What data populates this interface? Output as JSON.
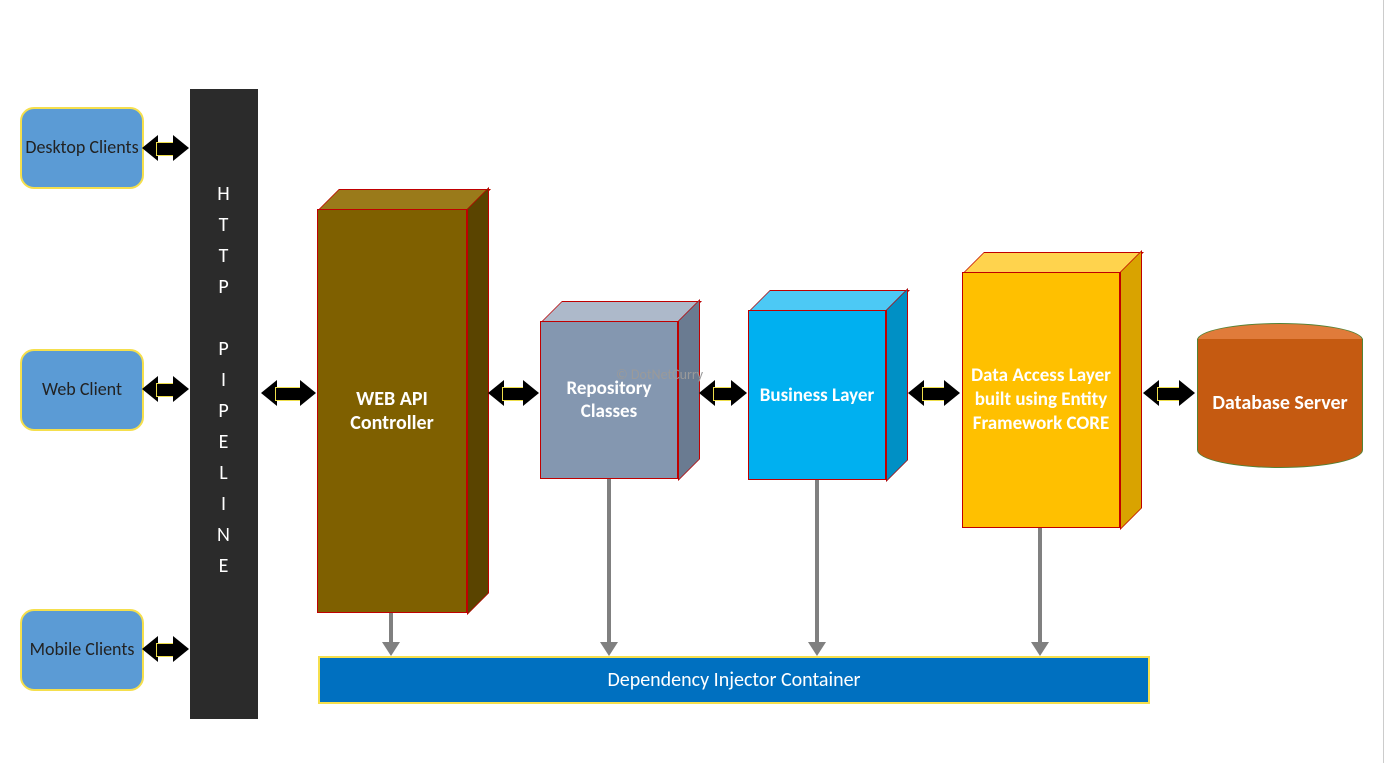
{
  "clients": {
    "desktop": "Desktop Clients",
    "web": "Web Client",
    "mobile": "Mobile Clients"
  },
  "pipeline": {
    "label_chars": "H\nT\nT\nP\n\nP\nI\nP\nE\nL\nI\nN\nE"
  },
  "cubes": {
    "webapi": "WEB API Controller",
    "repo": "Repository Classes",
    "biz": "Business Layer",
    "dal": "Data Access Layer built using Entity Framework CORE"
  },
  "database": "Database Server",
  "di_container": "Dependency Injector Container",
  "watermark": "© DotNetCurry"
}
